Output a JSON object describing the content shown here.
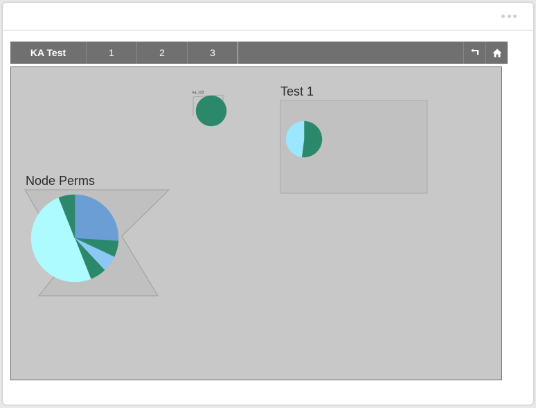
{
  "header": {
    "more_icon": "more-horizontal-icon"
  },
  "tabs": {
    "main_label": "KA Test",
    "items": [
      "1",
      "2",
      "3"
    ],
    "back_icon": "return-arrow-icon",
    "home_icon": "home-icon"
  },
  "widgets": {
    "small_pie": {
      "label": "ka_123",
      "slices": [
        {
          "color": "#2c886a",
          "value": 100
        }
      ]
    },
    "test1": {
      "title": "Test 1",
      "slices": [
        {
          "color": "#2c886a",
          "value": 52
        },
        {
          "color": "#9ce6ff",
          "value": 48
        }
      ]
    },
    "node_perms": {
      "title": "Node Perms",
      "slices": [
        {
          "color": "#6a9ed4",
          "value": 26
        },
        {
          "color": "#2c886a",
          "value": 6
        },
        {
          "color": "#8cc8f5",
          "value": 6
        },
        {
          "color": "#2c886a",
          "value": 6
        },
        {
          "color": "#adfaff",
          "value": 50
        },
        {
          "color": "#2c886a",
          "value": 6
        }
      ]
    }
  },
  "colors": {
    "toolbar": "#707070",
    "canvas": "#c8c8c8",
    "accent_green": "#2c886a"
  }
}
